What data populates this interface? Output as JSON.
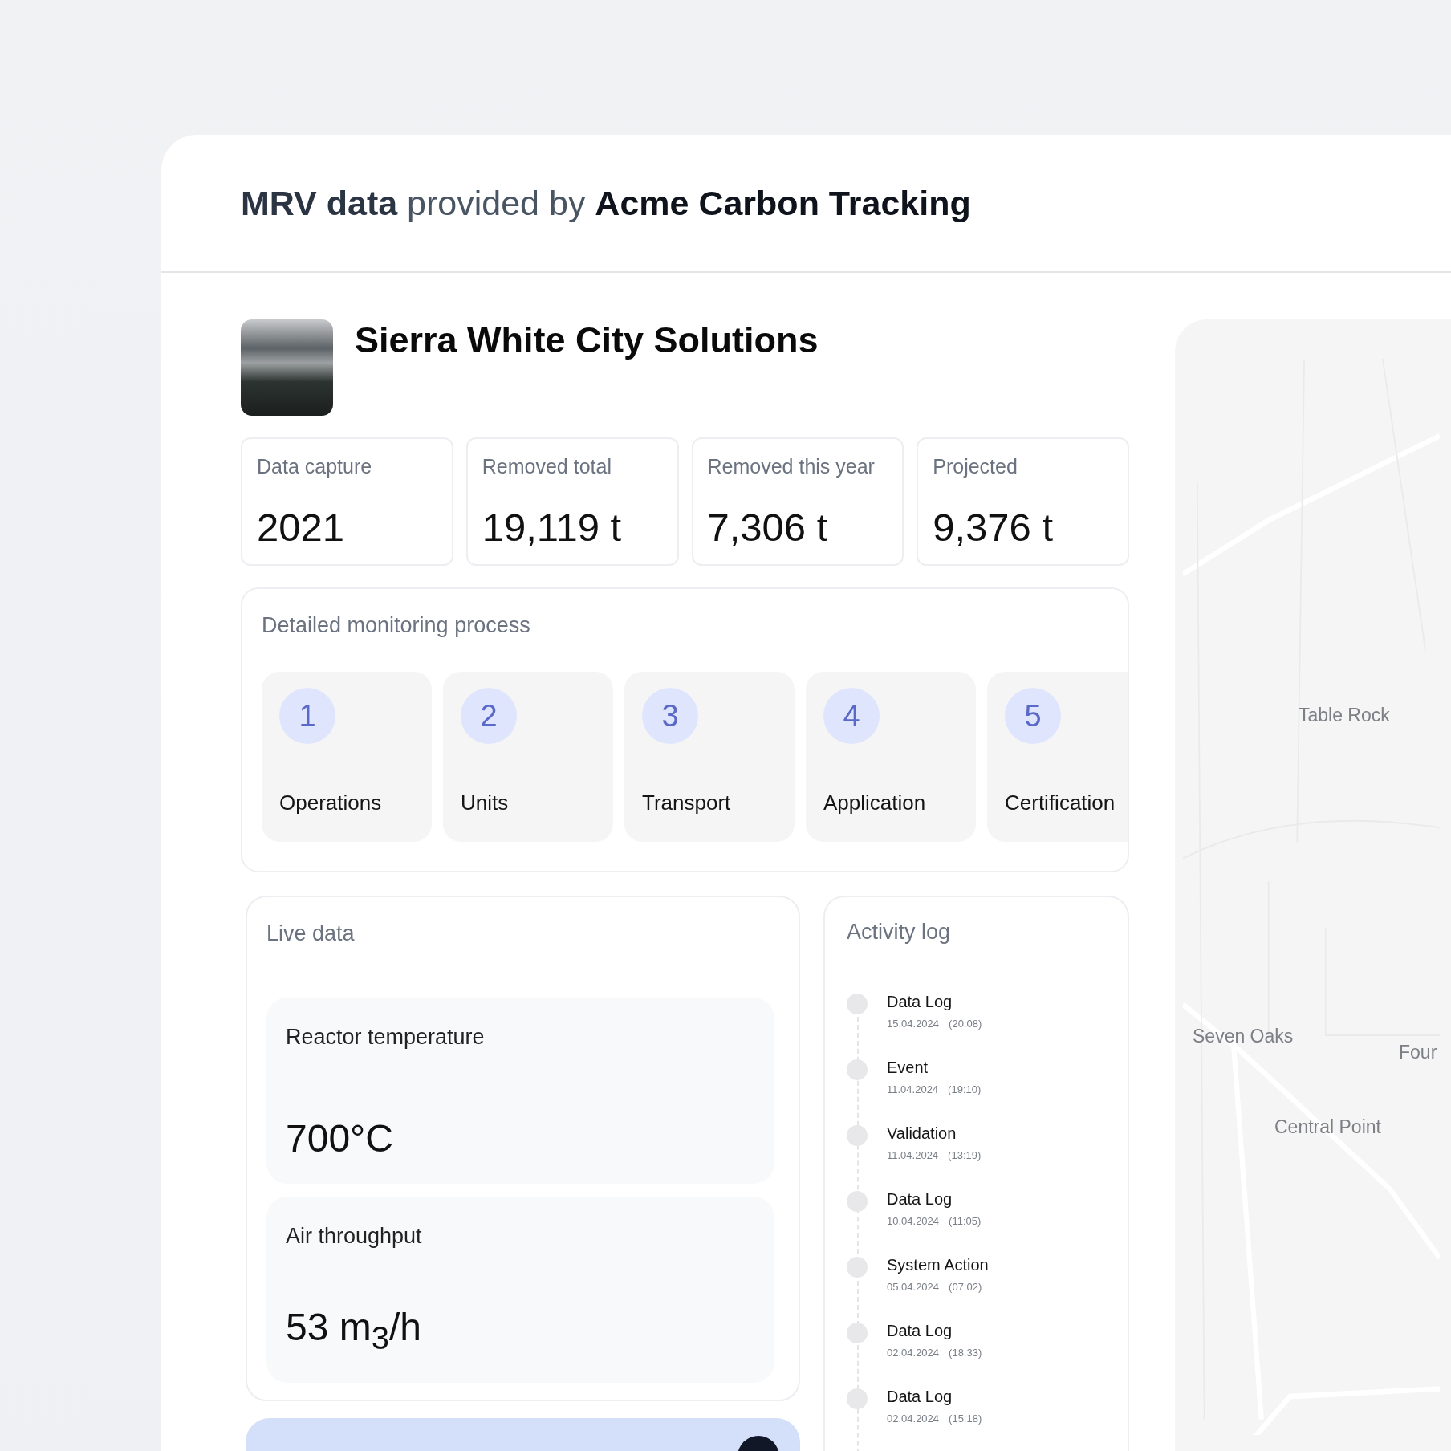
{
  "header": {
    "title": "**MRV data** provided by **Acme Carbon Tracking**"
  },
  "company": {
    "name": "Sierra White City Solutions"
  },
  "stats": [
    {
      "label": "Data capture",
      "value": "2021"
    },
    {
      "label": "Removed total",
      "value": "19,119 t"
    },
    {
      "label": "Removed this year",
      "value": "7,306 t"
    },
    {
      "label": "Projected",
      "value": "9,376 t"
    }
  ],
  "process": {
    "title": "Detailed monitoring process",
    "steps": [
      {
        "number": "1",
        "label": "Operations"
      },
      {
        "number": "2",
        "label": "Units"
      },
      {
        "number": "3",
        "label": "Transport"
      },
      {
        "number": "4",
        "label": "Application"
      },
      {
        "number": "5",
        "label": "Certification"
      }
    ]
  },
  "live_data": {
    "title": "Live data",
    "metrics": [
      {
        "label": "Reactor temperature",
        "value": "700°C"
      },
      {
        "label": "Air throughput",
        "value": "53 m$_{3}$/h"
      }
    ]
  },
  "activity_log": {
    "title": "Activity log",
    "items": [
      {
        "title": "Data Log",
        "date": "15.04.2024",
        "time": "(20:08)"
      },
      {
        "title": "Event",
        "date": "11.04.2024",
        "time": "(19:10)"
      },
      {
        "title": "Validation",
        "date": "11.04.2024",
        "time": "(13:19)"
      },
      {
        "title": "Data Log",
        "date": "10.04.2024",
        "time": "(11:05)"
      },
      {
        "title": "System Action",
        "date": "05.04.2024",
        "time": "(07:02)"
      },
      {
        "title": "Data Log",
        "date": "02.04.2024",
        "time": "(18:33)"
      },
      {
        "title": "Data Log",
        "date": "02.04.2024",
        "time": "(15:18)"
      }
    ]
  },
  "map": {
    "places": [
      {
        "name": "Table Rock"
      },
      {
        "name": "Seven Oaks"
      },
      {
        "name": "Four"
      },
      {
        "name": "Central Point"
      }
    ]
  }
}
